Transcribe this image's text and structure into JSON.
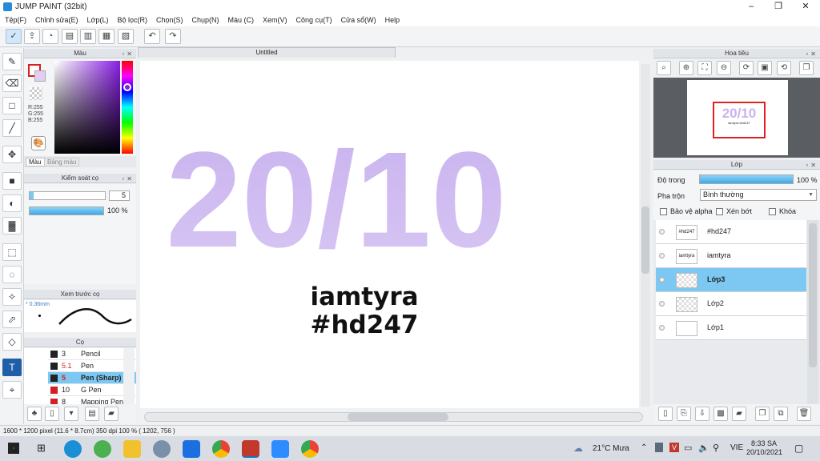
{
  "window": {
    "title": "JUMP PAINT (32bit)",
    "minimize": "–",
    "maximize": "❐",
    "close": "✕"
  },
  "menu": [
    "Tệp(F)",
    "Chỉnh sửa(E)",
    "Lớp(L)",
    "Bộ lọc(R)",
    "Chọn(S)",
    "Chụp(N)",
    "Màu (C)",
    "Xem(V)",
    "Công cụ(T)",
    "Cửa sổ(W)",
    "Help"
  ],
  "toolbar": {
    "undo": "↶",
    "redo": "↷"
  },
  "color_panel": {
    "title": "Màu",
    "rgb": [
      "R:255",
      "G:255",
      "B:255"
    ],
    "tab_color": "Màu",
    "tab_palette": "Bảng màu"
  },
  "brush_control": {
    "title": "Kiểm soát cọ",
    "size": "5",
    "opacity": "100 %",
    "opacity_fraction": 1.0
  },
  "brush_preview": {
    "title": "Xem trước cọ",
    "size_label": "* 0.36mm"
  },
  "brushes": {
    "title": "Cọ",
    "items": [
      {
        "size": "3",
        "name": "Pencil",
        "color": "#222222"
      },
      {
        "size": "5.1",
        "name": "Pen",
        "color": "#222222"
      },
      {
        "size": "5",
        "name": "Pen (Sharp)",
        "color": "#222222"
      },
      {
        "size": "10",
        "name": "G Pen",
        "color": "#d42020"
      },
      {
        "size": "8",
        "name": "Mapping Pen",
        "color": "#d42020"
      }
    ]
  },
  "document": {
    "tab": "Untitled",
    "big_text": "20/10",
    "line1": "iamtyra",
    "line2": "#hd247"
  },
  "navigator": {
    "title": "Hoa tiêu",
    "thumb_big": "20/10",
    "thumb_small": "iamtyra #hd247"
  },
  "layers_panel": {
    "title": "Lớp",
    "opacity_label": "Độ trong",
    "opacity_value": "100 %",
    "opacity_fraction": 1.0,
    "blend_label": "Pha trộn",
    "blend_value": "Bình thường",
    "protect_alpha": "Bảo vệ alpha",
    "clipping": "Xén bớt",
    "lock": "Khóa",
    "layers": [
      {
        "thumb_text": "#hd247",
        "name": "#hd247"
      },
      {
        "thumb_text": "iamtyra",
        "name": "iamtyra"
      },
      {
        "thumb_text": "",
        "name": "Lớp3"
      },
      {
        "thumb_text": "",
        "name": "Lớp2"
      },
      {
        "thumb_text": "",
        "name": "Lớp1"
      }
    ]
  },
  "status": {
    "text": "1600 * 1200 pixel   (11.6 * 8.7cm)   350 dpi   100 %   ( 1202, 756 )"
  },
  "taskbar": {
    "weather": "21°C  Mưa",
    "lang": "VIE",
    "time": "8:33 SA",
    "date": "20/10/2021"
  },
  "colors": {
    "accent": "#7cc8f2",
    "lilac": "#c9b3ef",
    "lilac_light": "#e2d6f7",
    "active_tool": "#1f5fa8"
  }
}
